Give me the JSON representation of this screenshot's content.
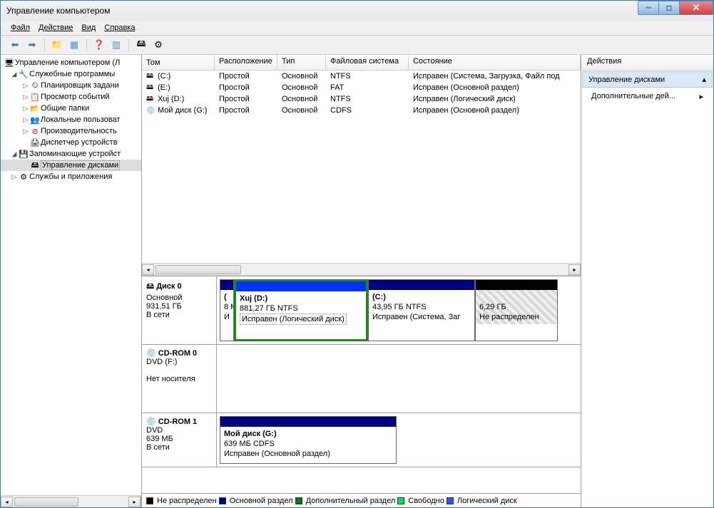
{
  "window": {
    "title": "Управление компьютером"
  },
  "menu": {
    "file": "Файл",
    "action": "Действие",
    "view": "Вид",
    "help": "Справка"
  },
  "tree": {
    "root": "Управление компьютером (Л",
    "sys_tools": "Служебные программы",
    "scheduler": "Планировщик задани",
    "events": "Просмотр событий",
    "shared": "Общие папки",
    "users": "Локальные пользоват",
    "perf": "Производительность",
    "devmgr": "Диспетчер устройств",
    "storage": "Запоминающие устройст",
    "diskmgmt": "Управление дисками",
    "services": "Службы и приложения"
  },
  "table": {
    "headers": {
      "tom": "Том",
      "ras": "Расположение",
      "tip": "Тип",
      "fs": "Файловая система",
      "sos": "Состояние"
    },
    "rows": [
      {
        "name": "(C:)",
        "icon": "drive",
        "layout": "Простой",
        "type": "Основной",
        "fs": "NTFS",
        "status": "Исправен (Система, Загрузка, Файл под"
      },
      {
        "name": "(E:)",
        "icon": "drive",
        "layout": "Простой",
        "type": "Основной",
        "fs": "FAT",
        "status": "Исправен (Основной раздел)"
      },
      {
        "name": "Xuj (D:)",
        "icon": "drive",
        "layout": "Простой",
        "type": "Основной",
        "fs": "NTFS",
        "status": "Исправен (Логический диск)"
      },
      {
        "name": "Мой диск (G:)",
        "icon": "disc",
        "layout": "Простой",
        "type": "Основной",
        "fs": "CDFS",
        "status": "Исправен (Основной раздел)"
      }
    ]
  },
  "disks": {
    "d0": {
      "name": "Диск 0",
      "type": "Основной",
      "size": "931,51 ГБ",
      "status": "В сети",
      "p0": {
        "title": "(",
        "line2": "8 М",
        "line3": "И"
      },
      "p1": {
        "title": "Xuj  (D:)",
        "line2": "881,27 ГБ NTFS",
        "line3": "Исправен (Логический диск)"
      },
      "p2": {
        "title": "(C:)",
        "line2": "43,95 ГБ NTFS",
        "line3": "Исправен (Система, Заг"
      },
      "p3": {
        "title": "",
        "line2": "6,29 ГБ",
        "line3": "Не распределен"
      }
    },
    "cd0": {
      "name": "CD-ROM 0",
      "type": "DVD (F:)",
      "status": "Нет носителя"
    },
    "cd1": {
      "name": "CD-ROM 1",
      "type": "DVD",
      "size": "639 МБ",
      "status": "В сети",
      "p0": {
        "title": "Мой диск  (G:)",
        "line2": "639 МБ CDFS",
        "line3": "Исправен (Основной раздел)"
      }
    }
  },
  "legend": {
    "unalloc": "Не распределен",
    "primary": "Основной раздел",
    "extended": "Дополнительный раздел",
    "free": "Свободно",
    "logical": "Логический диск"
  },
  "actions": {
    "header": "Действия",
    "diskmgmt": "Управление дисками",
    "more": "Дополнительные дей..."
  }
}
